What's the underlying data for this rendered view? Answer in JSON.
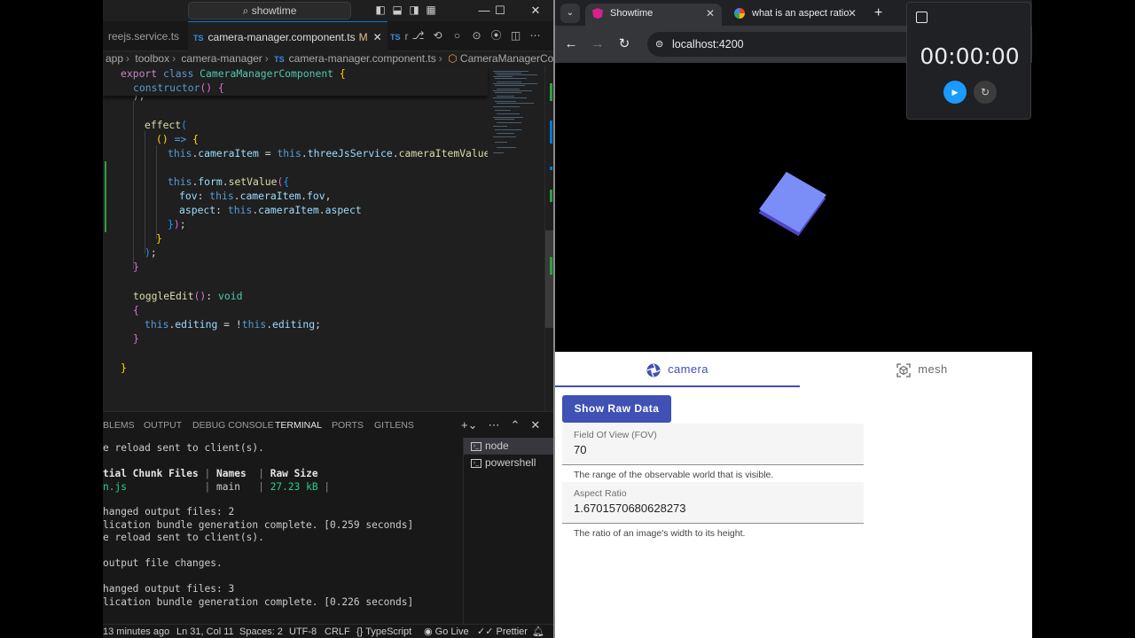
{
  "vscode": {
    "search": "showtime",
    "tabs": [
      {
        "label": "reejs.service.ts"
      },
      {
        "label": "camera-manager.component.ts",
        "badge": "TS",
        "modified": "M",
        "close": "✕"
      },
      {
        "label": "r",
        "badge": "TS"
      }
    ],
    "breadcrumb": [
      "app",
      "toolbox",
      "camera-manager",
      "camera-manager.component.ts",
      "CameraManagerComponent"
    ],
    "breadcrumb_badge": "TS",
    "code": {
      "l1": [
        "export",
        " ",
        "class",
        " ",
        "CameraManagerComponent",
        " ",
        "{"
      ],
      "l2": [
        "constructor",
        "()",
        " ",
        "{"
      ],
      "l3": [
        "effect",
        "("
      ],
      "l4": [
        "()",
        " ",
        "=>",
        " ",
        "{"
      ],
      "l5": [
        "this",
        ".",
        "cameraItem",
        " = ",
        "this",
        ".",
        "threeJsService",
        ".",
        "cameraItemValues",
        "("
      ],
      "l6": [
        "this",
        ".",
        "form",
        ".",
        "setValue",
        "(",
        "{"
      ],
      "l7": [
        "fov",
        ": ",
        "this",
        ".",
        "cameraItem",
        ".",
        "fov",
        ","
      ],
      "l8": [
        "aspect",
        ": ",
        "this",
        ".",
        "cameraItem",
        ".",
        "aspect"
      ],
      "l9": [
        "}",
        ")",
        ";"
      ],
      "l10": "}",
      "l11": [
        ")",
        ";"
      ],
      "l12": "}",
      "l13": [
        "toggleEdit",
        "()",
        ": ",
        "void"
      ],
      "l14": "{",
      "l15": [
        "this",
        ".",
        "editing",
        " = !",
        "this",
        ".",
        "editing",
        ";"
      ],
      "l16": "}",
      "l17": "}",
      "l0": "  );"
    },
    "panel_tabs": [
      "BLEMS",
      "OUTPUT",
      "DEBUG CONSOLE",
      "TERMINAL",
      "PORTS",
      "GITLENS"
    ],
    "terminal_lines": [
      "e reload sent to client(s).",
      "",
      "tial Chunk Files",
      "n.js",
      "",
      "hanged output files: 2",
      "lication bundle generation complete. [0.259 seconds]",
      "e reload sent to client(s).",
      "",
      "output file changes.",
      "",
      "hanged output files: 3",
      "lication bundle generation complete. [0.226 seconds]"
    ],
    "chunk_header": {
      "names": "Names",
      "raw_size": "Raw Size",
      "sep": "|"
    },
    "chunk_row": {
      "names": "main",
      "raw_size": "27.23 kB",
      "sep": "|"
    },
    "terminals": [
      "node",
      "powershell"
    ],
    "status": {
      "time": "13 minutes ago",
      "position": "Ln 31, Col 11",
      "spaces": "Spaces: 2",
      "encoding": "UTF-8",
      "eol": "CRLF",
      "language": "TypeScript",
      "golive": "Go Live",
      "prettier": "Prettier"
    }
  },
  "chrome": {
    "tabs": [
      {
        "title": "Showtime"
      },
      {
        "title": "what is an aspect ratio"
      }
    ],
    "url": "localhost:4200",
    "colors": {
      "cube": "#7b8ef7",
      "cube_shadow": "#4f48c8"
    }
  },
  "app": {
    "tabs": [
      {
        "label": "camera",
        "icon": "camera-icon"
      },
      {
        "label": "mesh",
        "icon": "mesh-icon"
      }
    ],
    "button": "Show Raw Data",
    "fields": [
      {
        "label": "Field Of View (FOV)",
        "value": "70",
        "hint": "The range of the observable world that is visible."
      },
      {
        "label": "Aspect Ratio",
        "value": "1.6701570680628273",
        "hint": "The ratio of an image's width to its height."
      }
    ],
    "accent": "#3f51b5"
  },
  "timer": {
    "display": "00:00:00"
  }
}
